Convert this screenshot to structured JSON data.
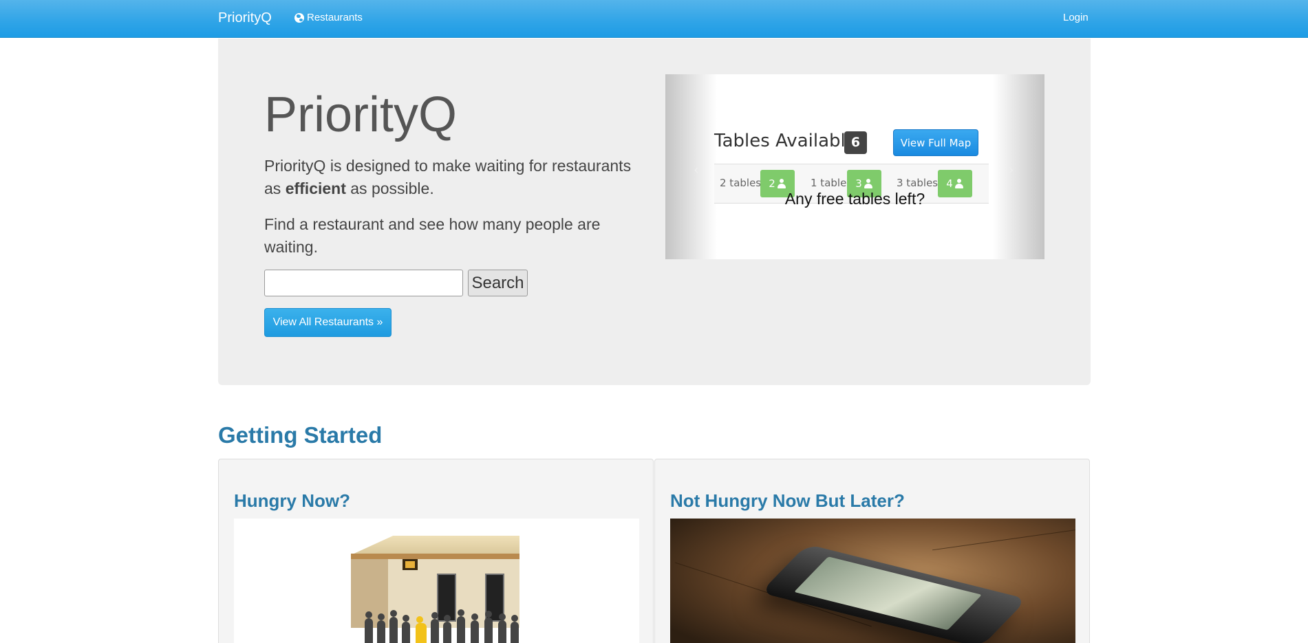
{
  "navbar": {
    "brand": "PriorityQ",
    "restaurants_link": "Restaurants",
    "login_link": "Login"
  },
  "hero": {
    "title": "PriorityQ",
    "tagline_before": "PriorityQ is designed to make waiting for restaurants as ",
    "tagline_bold": "efficient",
    "tagline_after": " as possible.",
    "find_text": "Find a restaurant and see how many people are waiting.",
    "search_input_value": "",
    "search_button": "Search",
    "view_all_button": "View All Restaurants »"
  },
  "carousel": {
    "slide_heading": "Tables Available",
    "available_count": "6",
    "view_map_button": "View Full Map",
    "tables": [
      {
        "label": "2 tables",
        "size": "2"
      },
      {
        "label": "1 table",
        "size": "3"
      },
      {
        "label": "3 tables",
        "size": "4"
      }
    ],
    "caption": "Any free tables left?",
    "prev_glyph": "‹",
    "next_glyph": "›"
  },
  "getting_started": {
    "heading": "Getting Started",
    "panels": [
      {
        "title": "Hungry Now?",
        "image": "restaurant-queue-illustration"
      },
      {
        "title": "Not Hungry Now But Later?",
        "image": "smartphone-on-table-photo"
      }
    ]
  },
  "colors": {
    "navbar": "#2fa4e7",
    "link_heading": "#2a7aa8",
    "badge_green": "#7fcb6b",
    "jumbotron_bg": "#eeeeee"
  }
}
